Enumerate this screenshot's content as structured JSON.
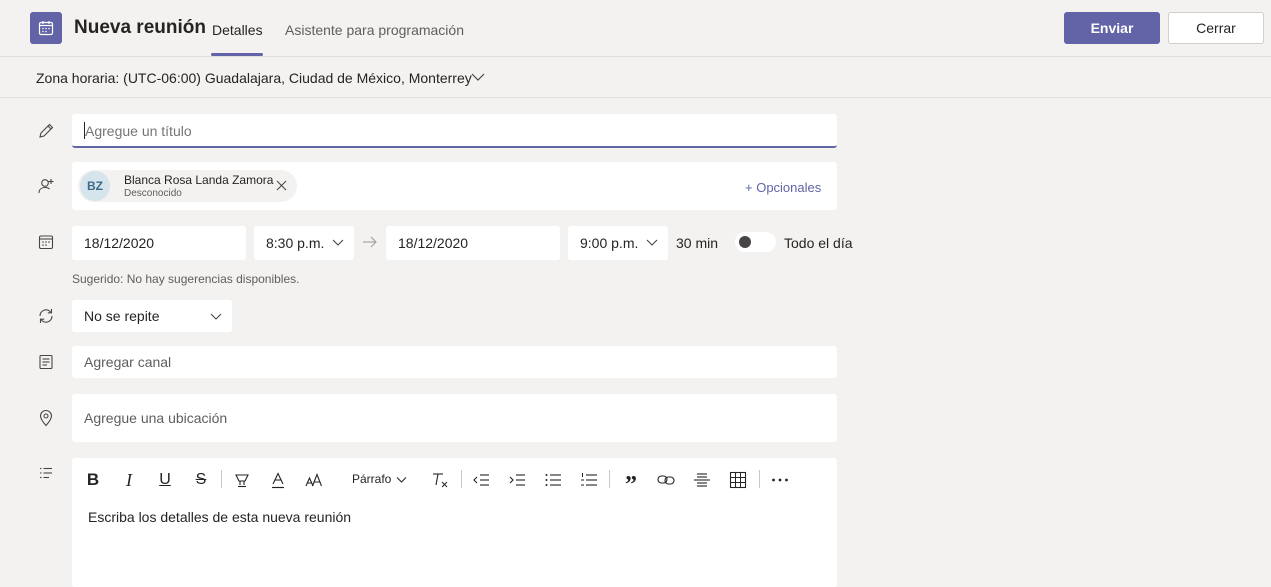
{
  "header": {
    "title": "Nueva reunión",
    "tabs": [
      {
        "label": "Detalles",
        "active": true
      },
      {
        "label": "Asistente para programación",
        "active": false
      }
    ],
    "send_label": "Enviar",
    "close_label": "Cerrar"
  },
  "timezone": {
    "label": "Zona horaria: (UTC-06:00) Guadalajara, Ciudad de México, Monterrey"
  },
  "title_field": {
    "placeholder": "Agregue un título",
    "value": ""
  },
  "attendees": {
    "items": [
      {
        "initials": "BZ",
        "name": "Blanca Rosa Landa Zamora",
        "status": "Desconocido"
      }
    ],
    "optional_label": "+ Opcionales"
  },
  "schedule": {
    "start_date": "18/12/2020",
    "start_time": "8:30 p.m.",
    "end_date": "18/12/2020",
    "end_time": "9:00 p.m.",
    "duration": "30 min",
    "all_day_label": "Todo el día",
    "all_day": false,
    "suggestion": "Sugerido: No hay sugerencias disponibles."
  },
  "repeat": {
    "value": "No se repite"
  },
  "channel": {
    "placeholder": "Agregar canal"
  },
  "location": {
    "placeholder": "Agregue una ubicación"
  },
  "editor": {
    "paragraph_label": "Párrafo",
    "placeholder": "Escriba los detalles de esta nueva reunión",
    "toolbar": [
      "bold-icon",
      "italic-icon",
      "underline-icon",
      "strikethrough-icon",
      "highlight-icon",
      "font-color-icon",
      "font-size-icon",
      "paragraph-format",
      "clear-format-icon",
      "decrease-indent-icon",
      "increase-indent-icon",
      "bulleted-list-icon",
      "numbered-list-icon",
      "quote-icon",
      "link-icon",
      "horizontal-rule-icon",
      "table-icon",
      "more-options-icon"
    ]
  },
  "colors": {
    "accent": "#6264a7",
    "background": "#f3f2f1",
    "field": "#ffffff"
  }
}
